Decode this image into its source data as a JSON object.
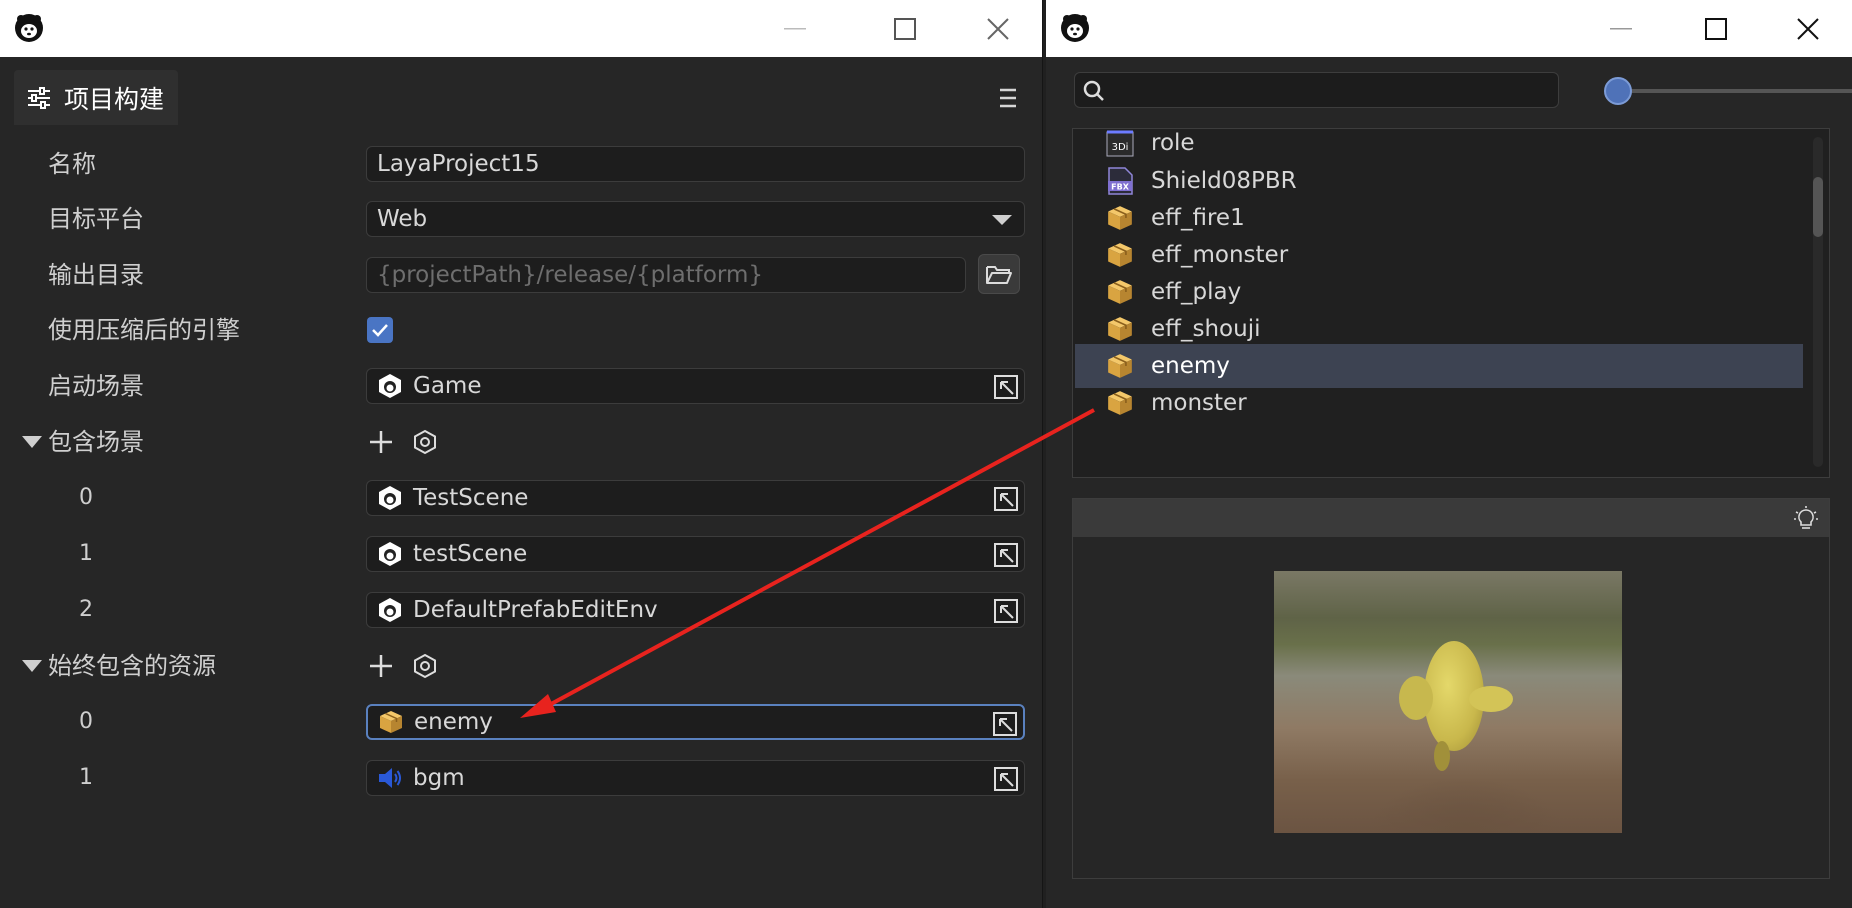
{
  "left_window": {
    "panel_title": "项目构建",
    "properties": {
      "name_label": "名称",
      "name_value": "LayaProject15",
      "platform_label": "目标平台",
      "platform_value": "Web",
      "output_label": "输出目录",
      "output_placeholder": "{projectPath}/release/{platform}",
      "compressed_label": "使用压缩后的引擎",
      "compressed_checked": true,
      "start_scene_label": "启动场景",
      "start_scene_value": "Game",
      "include_scenes_label": "包含场景",
      "include_scenes": [
        {
          "index": "0",
          "value": "TestScene"
        },
        {
          "index": "1",
          "value": "testScene"
        },
        {
          "index": "2",
          "value": "DefaultPrefabEditEnv"
        }
      ],
      "always_include_label": "始终包含的资源",
      "always_include": [
        {
          "index": "0",
          "value": "enemy",
          "icon": "prefab-icon"
        },
        {
          "index": "1",
          "value": "bgm",
          "icon": "speaker-icon"
        }
      ]
    }
  },
  "right_window": {
    "search_value": "",
    "zoom_level": 0.0,
    "files": [
      {
        "name": "role",
        "icon": "3d-icon"
      },
      {
        "name": "Shield08PBR",
        "icon": "fbx-icon"
      },
      {
        "name": "eff_fire1",
        "icon": "prefab-icon"
      },
      {
        "name": "eff_monster",
        "icon": "prefab-icon"
      },
      {
        "name": "eff_play",
        "icon": "prefab-icon"
      },
      {
        "name": "eff_shouji",
        "icon": "prefab-icon"
      },
      {
        "name": "enemy",
        "icon": "prefab-icon",
        "selected": true
      },
      {
        "name": "monster",
        "icon": "prefab-icon"
      }
    ]
  },
  "colors": {
    "accent": "#4a75c4",
    "selection": "#3d4352",
    "drag_arrow": "#e8231e",
    "background": "#262626"
  }
}
